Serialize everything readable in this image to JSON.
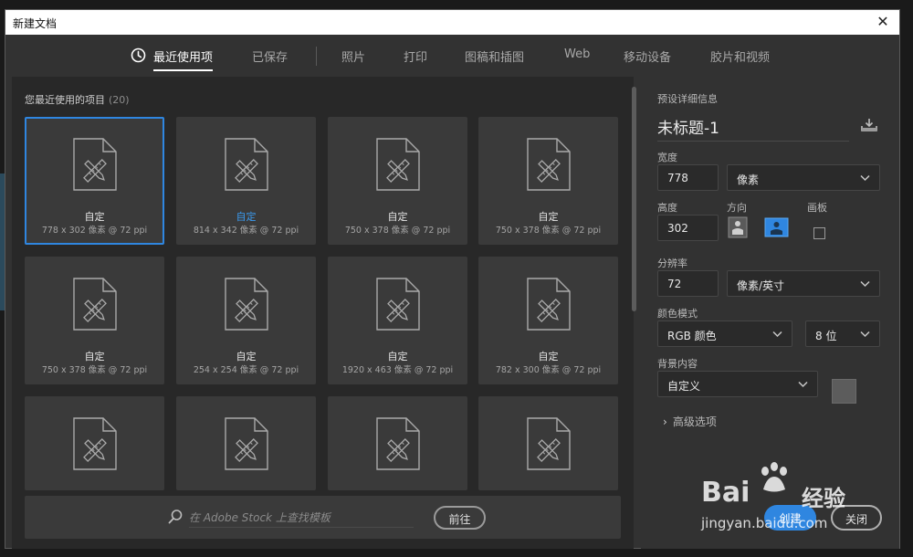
{
  "dialog": {
    "title": "新建文档",
    "close_glyph": "✕"
  },
  "tabs": [
    {
      "label": "最近使用项",
      "active": true
    },
    {
      "label": "已保存"
    },
    {
      "label": "照片"
    },
    {
      "label": "打印"
    },
    {
      "label": "图稿和插图"
    },
    {
      "label": "Web"
    },
    {
      "label": "移动设备"
    },
    {
      "label": "胶片和视频"
    }
  ],
  "recent": {
    "label": "您最近使用的项目",
    "count": "(20)",
    "items": [
      {
        "name": "自定",
        "dims": "778 x 302 像素 @ 72 ppi",
        "selected": true
      },
      {
        "name": "自定",
        "dims": "814 x 342 像素 @ 72 ppi",
        "highlight_name": true
      },
      {
        "name": "自定",
        "dims": "750 x 378 像素 @ 72 ppi"
      },
      {
        "name": "自定",
        "dims": "750 x 378 像素 @ 72 ppi"
      },
      {
        "name": "自定",
        "dims": "750 x 378 像素 @ 72 ppi"
      },
      {
        "name": "自定",
        "dims": "254 x 254 像素 @ 72 ppi"
      },
      {
        "name": "自定",
        "dims": "1920 x 463 像素 @ 72 ppi"
      },
      {
        "name": "自定",
        "dims": "782 x 300 像素 @ 72 ppi"
      },
      {
        "name": "",
        "dims": ""
      },
      {
        "name": "",
        "dims": ""
      },
      {
        "name": "",
        "dims": ""
      },
      {
        "name": "",
        "dims": ""
      }
    ]
  },
  "stock": {
    "placeholder": "在 Adobe Stock 上查找模板",
    "button": "前往"
  },
  "preset": {
    "section_label": "预设详细信息",
    "doc_title": "未标题-1",
    "width_label": "宽度",
    "width_value": "778",
    "width_unit": "像素",
    "height_label": "高度",
    "height_value": "302",
    "orientation_label": "方向",
    "artboard_label": "画板",
    "resolution_label": "分辨率",
    "resolution_value": "72",
    "resolution_unit": "像素/英寸",
    "color_mode_label": "颜色模式",
    "color_mode_value": "RGB 颜色",
    "bit_depth_value": "8 位",
    "background_label": "背景内容",
    "background_value": "自定义",
    "background_swatch": "#5c5c5c",
    "advanced_label": "高级选项"
  },
  "footer": {
    "create_label": "创建",
    "close_label": "关闭"
  },
  "watermark": {
    "brand_left": "Bai",
    "brand_right": "经验",
    "url": "jingyan.baidu.com"
  },
  "colors": {
    "accent": "#2f86e0",
    "panel": "#323232",
    "card": "#3a3a3a"
  },
  "icons": [
    "clock-icon",
    "document-icon",
    "search-icon",
    "save-preset-icon",
    "chevron-down-icon",
    "portrait-icon",
    "landscape-icon"
  ]
}
